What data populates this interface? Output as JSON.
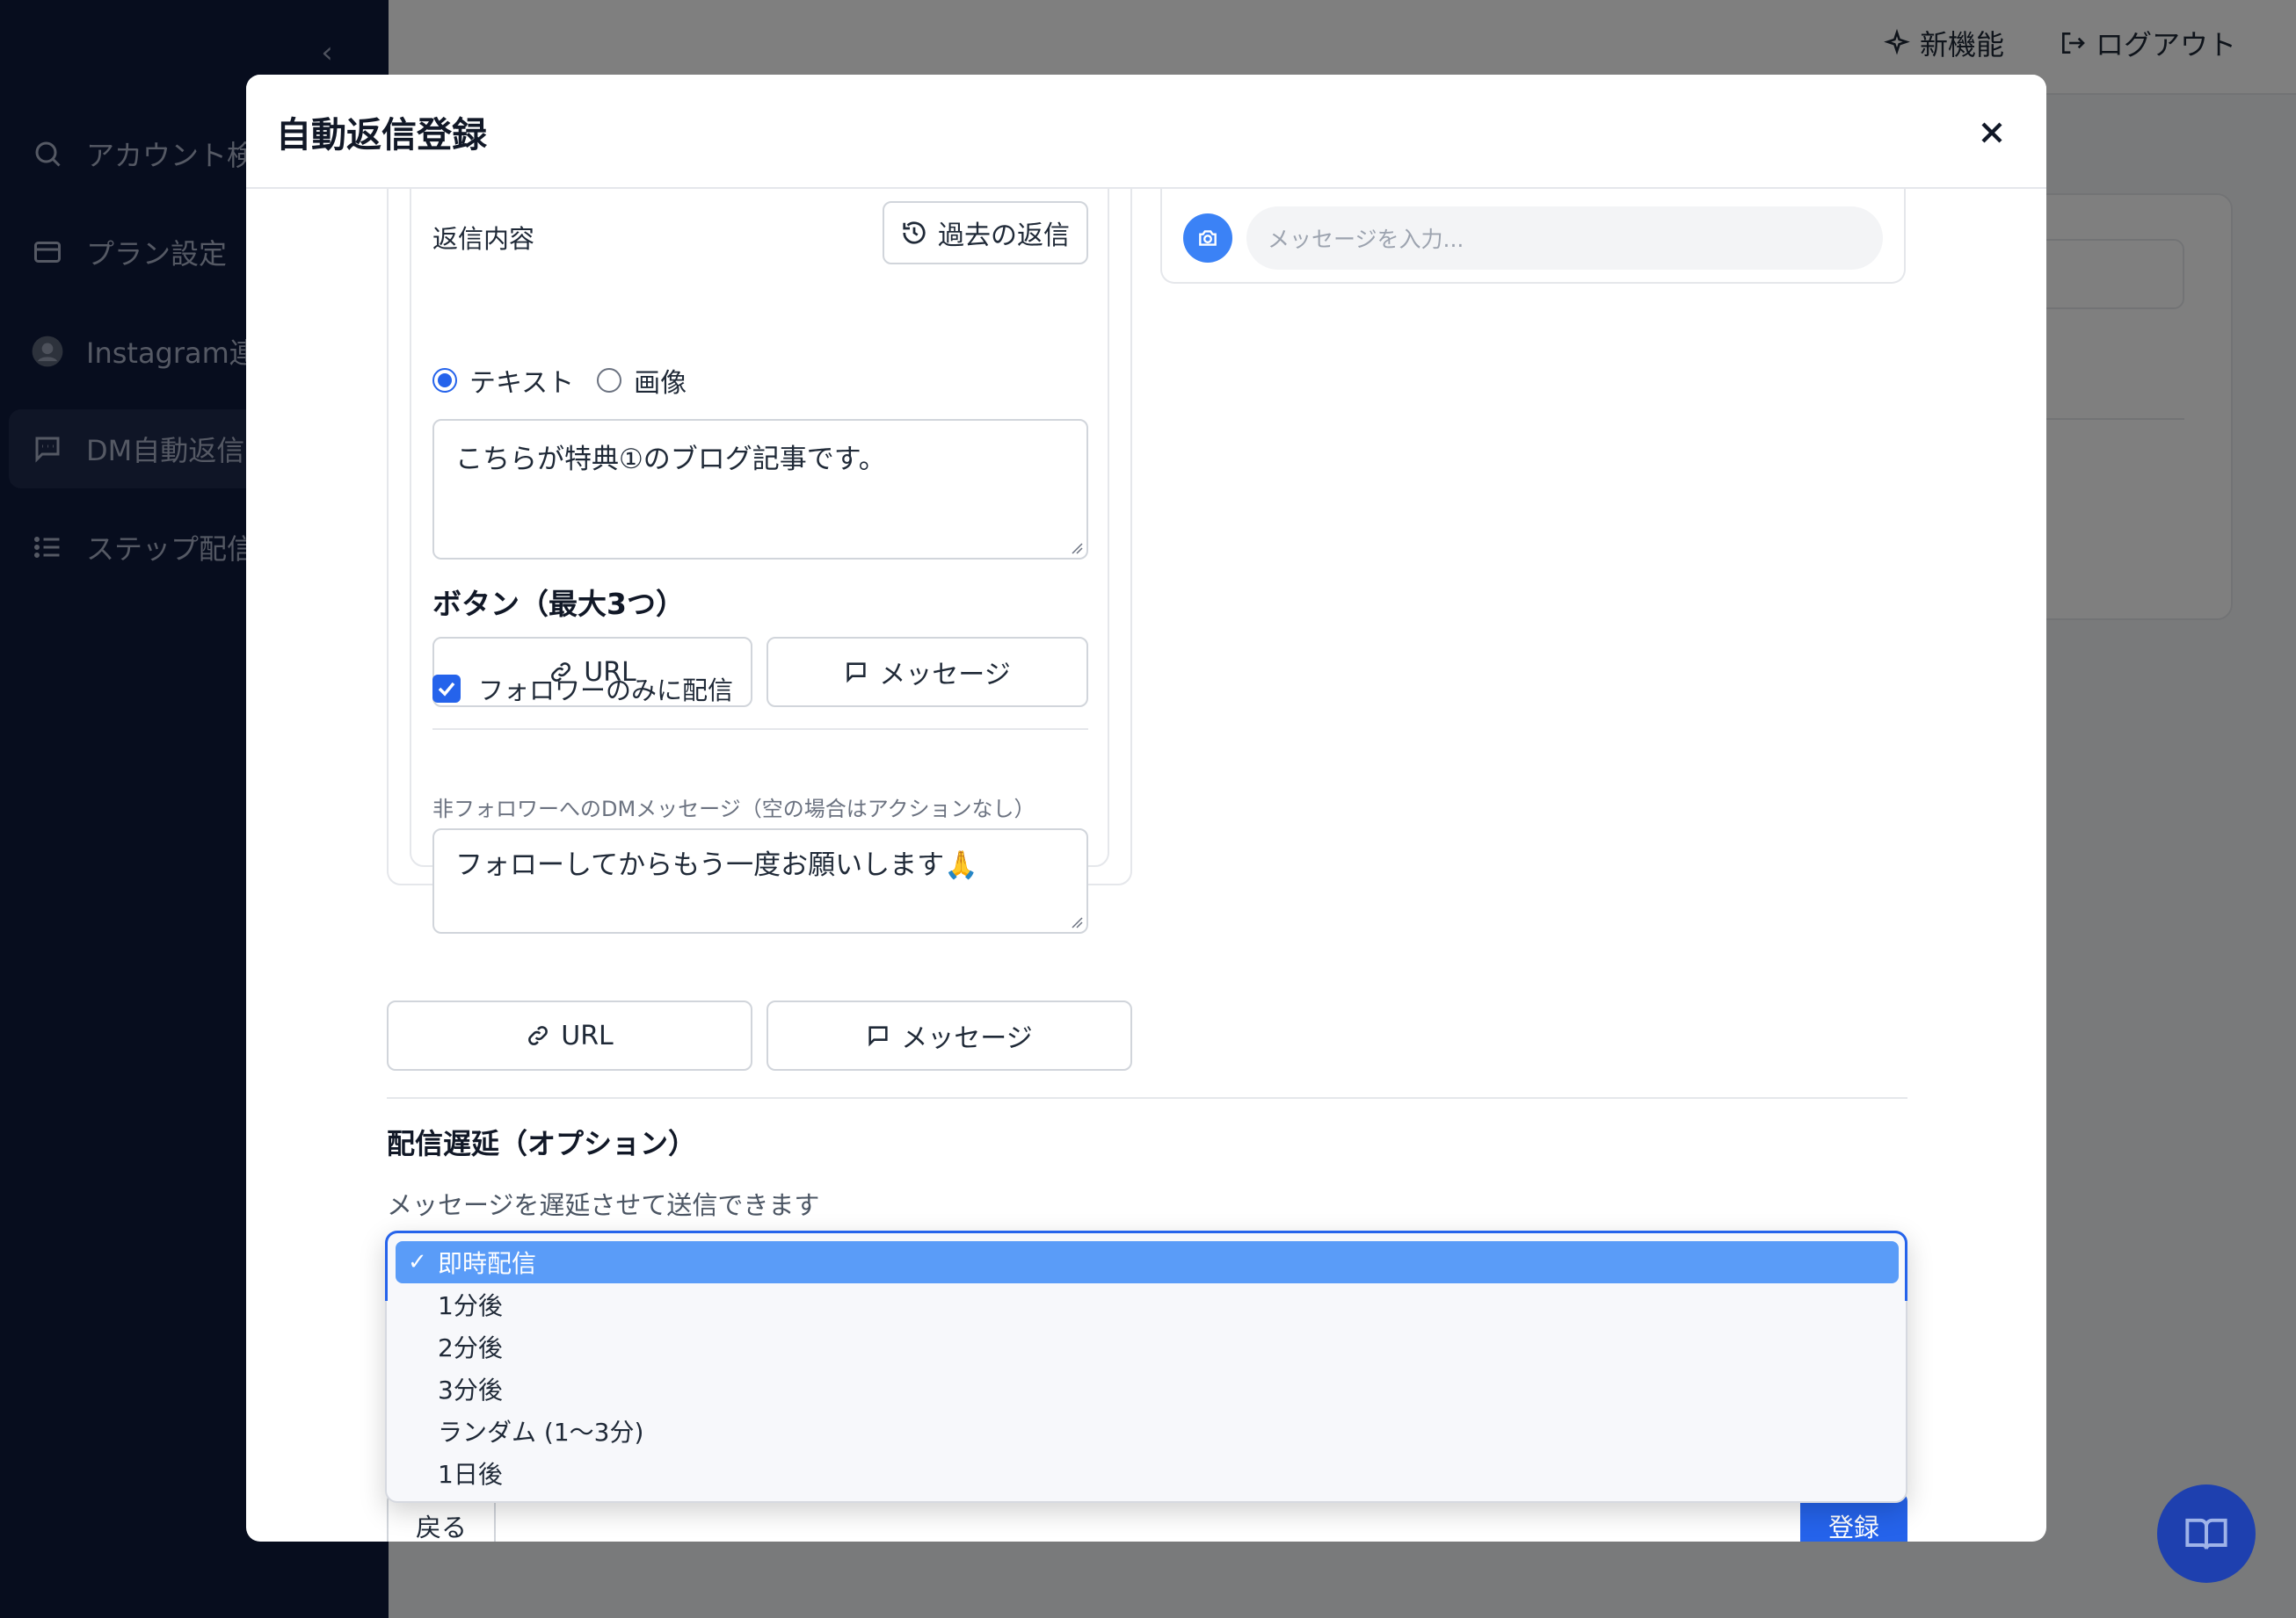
{
  "sidebar": {
    "items": [
      {
        "label": "アカウント検索",
        "icon": "search-icon"
      },
      {
        "label": "プラン設定",
        "icon": "card-icon"
      },
      {
        "label": "Instagram連携",
        "icon": "avatar-icon"
      },
      {
        "label": "DM自動返信",
        "icon": "chat-icon"
      },
      {
        "label": "ステップ配信",
        "icon": "list-icon"
      }
    ]
  },
  "topbar": {
    "new_features": "新機能",
    "logout": "ログアウト"
  },
  "modal": {
    "title": "自動返信登録",
    "reply": {
      "label": "返信内容",
      "history_button": "過去の返信",
      "type_text": "テキスト",
      "type_image": "画像",
      "selected_type": "テキスト",
      "message": "こちらが特典①のブログ記事です。"
    },
    "buttons_section": {
      "title": "ボタン（最大3つ）",
      "url_label": "URL",
      "message_label": "メッセージ"
    },
    "followers_only": {
      "label": "フォロワーのみに配信",
      "checked": true,
      "hint": "非フォロワーへのDMメッセージ（空の場合はアクションなし）",
      "message": "フォローしてからもう一度お願いします🙏"
    },
    "outer_buttons": {
      "url_label": "URL",
      "message_label": "メッセージ"
    },
    "preview": {
      "input_placeholder": "メッセージを入力..."
    },
    "delay": {
      "title": "配信遅延（オプション）",
      "description": "メッセージを遅延させて送信できます",
      "options": [
        "即時配信",
        "1分後",
        "2分後",
        "3分後",
        "ランダム (1〜3分)",
        "1日後"
      ],
      "selected": "即時配信"
    },
    "back_button": "戻る",
    "submit_button": "登録"
  },
  "colors": {
    "primary": "#2563eb",
    "sidebar_bg": "#0f1a3d",
    "selected_option": "#5a9cf8"
  }
}
